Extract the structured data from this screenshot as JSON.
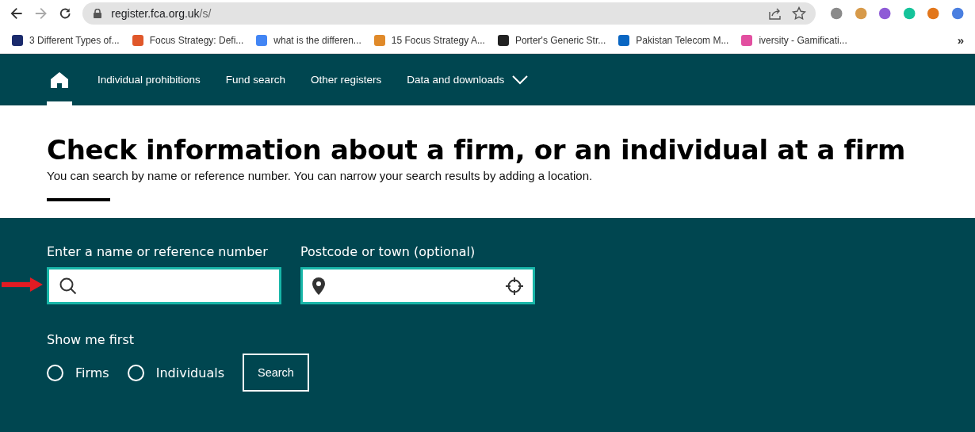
{
  "browser": {
    "url_host": "register.fca.org.uk",
    "url_path": "/s/",
    "forward_disabled": true,
    "bookmarks": [
      {
        "label": "3 Different Types of...",
        "color": "#1a2a6c"
      },
      {
        "label": "Focus Strategy: Defi...",
        "color": "#e0572a"
      },
      {
        "label": "what is the differen...",
        "color": "#4285f4"
      },
      {
        "label": "15 Focus Strategy A...",
        "color": "#e08a2a"
      },
      {
        "label": "Porter's Generic Str...",
        "color": "#222222"
      },
      {
        "label": "Pakistan Telecom M...",
        "color": "#0a66c2"
      },
      {
        "label": "iversity - Gamificati...",
        "color": "#e24fa0"
      }
    ],
    "overflow": "»",
    "extensions": [
      {
        "color": "#8a8a8a"
      },
      {
        "color": "#d79a4a"
      },
      {
        "color": "#8e5bd6"
      },
      {
        "color": "#15c39a"
      },
      {
        "color": "#e2761b"
      },
      {
        "color": "#4a7fe0"
      }
    ]
  },
  "nav": {
    "items": [
      {
        "kind": "home",
        "selected": true
      },
      {
        "kind": "link",
        "label": "Individual prohibitions",
        "selected": false
      },
      {
        "kind": "link",
        "label": "Fund search",
        "selected": false
      },
      {
        "kind": "link",
        "label": "Other registers",
        "selected": false
      },
      {
        "kind": "dropdown",
        "label": "Data and downloads",
        "selected": false
      }
    ]
  },
  "hero": {
    "title": "Check information about a firm, or an individual at a firm",
    "subtitle": "You can search by name or reference number. You can narrow your search results by adding a location."
  },
  "search": {
    "name_label": "Enter a name or reference number",
    "location_label": "Postcode or town (optional)",
    "show_label": "Show me first",
    "options": [
      {
        "label": "Firms",
        "selected": false
      },
      {
        "label": "Individuals",
        "selected": false
      }
    ],
    "button": "Search"
  }
}
